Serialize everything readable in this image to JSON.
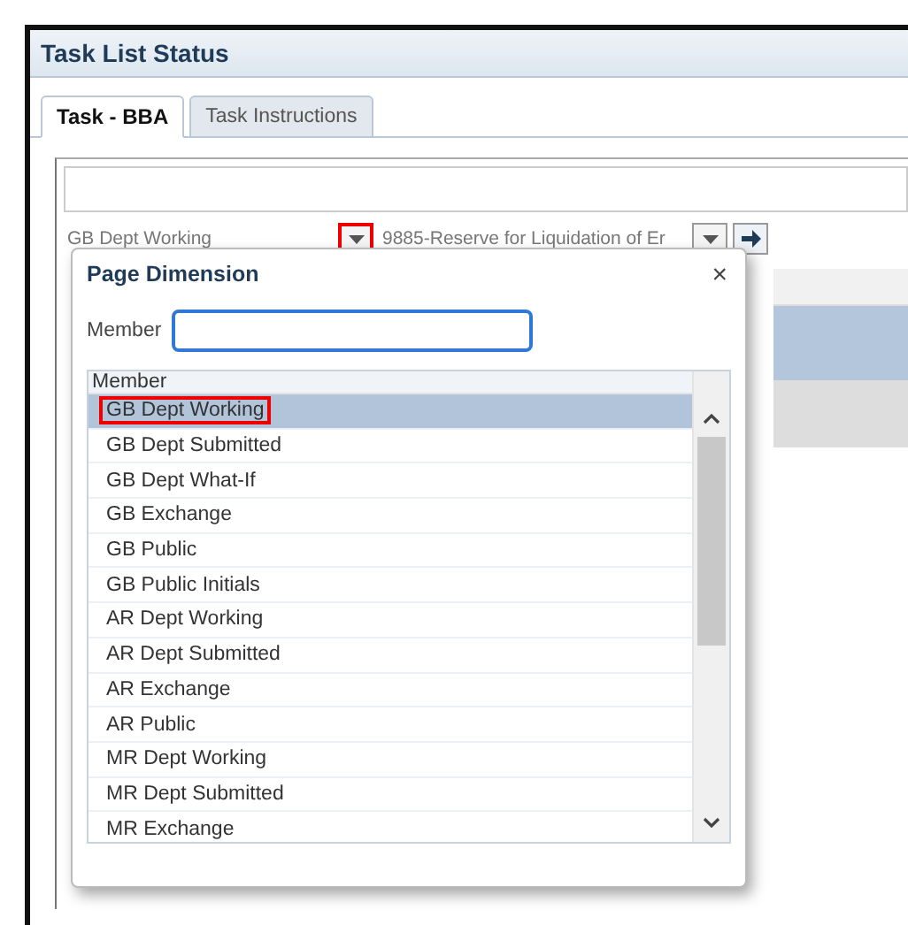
{
  "window": {
    "title": "Task List Status"
  },
  "tabs": [
    {
      "label": "Task - BBA",
      "selected": true
    },
    {
      "label": "Task Instructions",
      "selected": false
    }
  ],
  "page_selectors": [
    {
      "value": "GB Dept Working",
      "highlighted": true
    },
    {
      "value": "9885-Reserve for Liquidation of Er",
      "highlighted": false
    }
  ],
  "dialog": {
    "title": "Page Dimension",
    "close": "×",
    "member_label": "Member",
    "list_header": "Member",
    "items": [
      {
        "label": "GB Dept Working",
        "selected": true
      },
      {
        "label": "GB Dept Submitted",
        "selected": false
      },
      {
        "label": "GB Dept What-If",
        "selected": false
      },
      {
        "label": "GB Exchange",
        "selected": false
      },
      {
        "label": "GB Public",
        "selected": false
      },
      {
        "label": "GB Public Initials",
        "selected": false
      },
      {
        "label": "AR Dept Working",
        "selected": false
      },
      {
        "label": "AR Dept Submitted",
        "selected": false
      },
      {
        "label": "AR Exchange",
        "selected": false
      },
      {
        "label": "AR Public",
        "selected": false
      },
      {
        "label": "MR Dept Working",
        "selected": false
      },
      {
        "label": "MR Dept Submitted",
        "selected": false
      },
      {
        "label": "MR Exchange",
        "selected": false
      }
    ]
  }
}
